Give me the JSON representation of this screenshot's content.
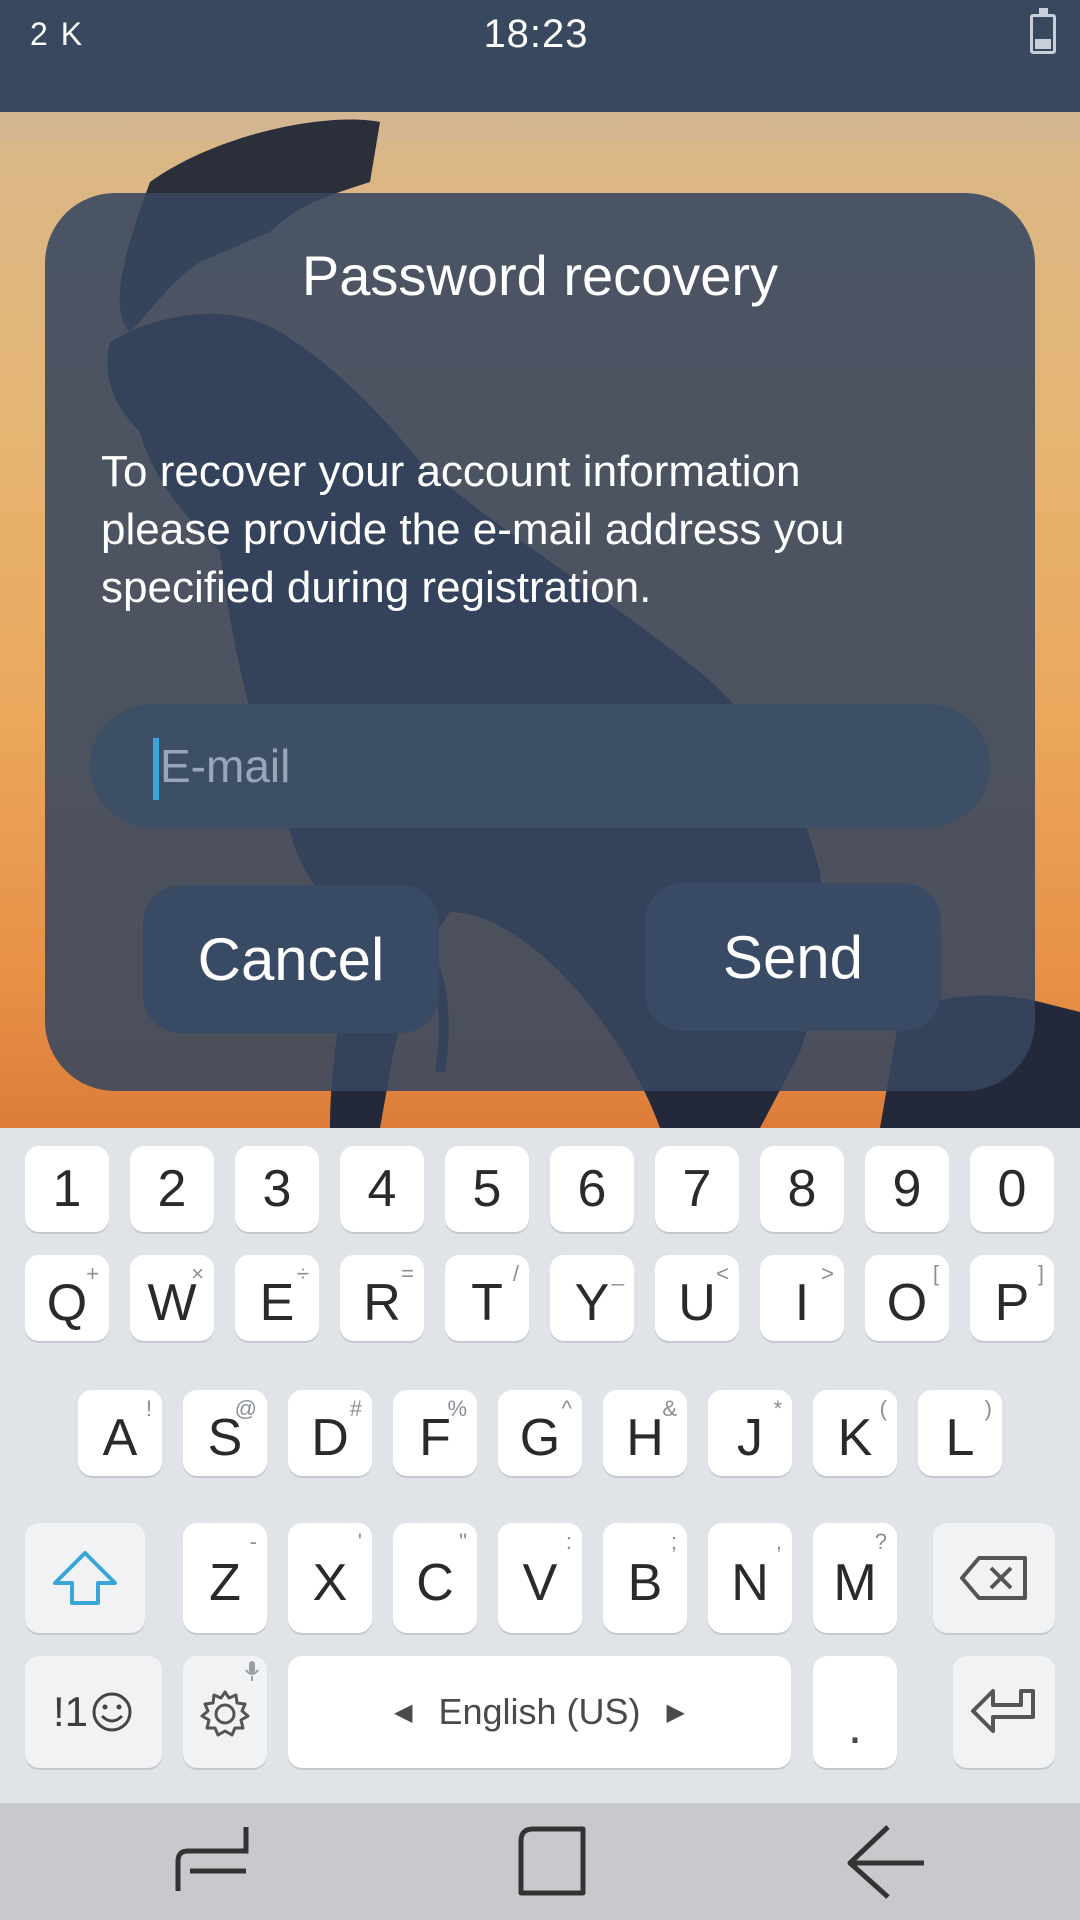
{
  "status_bar": {
    "left_text": "2 K",
    "time": "18:23"
  },
  "dialog": {
    "title": "Password recovery",
    "message": " To recover your account information\nplease provide the e-mail address you\nspecified during registration.",
    "email_placeholder": "E-mail",
    "email_value": "",
    "cancel_label": "Cancel",
    "send_label": "Send"
  },
  "keyboard": {
    "number_row": [
      "1",
      "2",
      "3",
      "4",
      "5",
      "6",
      "7",
      "8",
      "9",
      "0"
    ],
    "row1": [
      {
        "main": "Q",
        "sub": "+"
      },
      {
        "main": "W",
        "sub": "×"
      },
      {
        "main": "E",
        "sub": "÷"
      },
      {
        "main": "R",
        "sub": "="
      },
      {
        "main": "T",
        "sub": "/"
      },
      {
        "main": "Y",
        "sub": "_"
      },
      {
        "main": "U",
        "sub": "<"
      },
      {
        "main": "I",
        "sub": ">"
      },
      {
        "main": "O",
        "sub": "["
      },
      {
        "main": "P",
        "sub": "]"
      }
    ],
    "row2": [
      {
        "main": "A",
        "sub": "!"
      },
      {
        "main": "S",
        "sub": "@"
      },
      {
        "main": "D",
        "sub": "#"
      },
      {
        "main": "F",
        "sub": "%"
      },
      {
        "main": "G",
        "sub": "^"
      },
      {
        "main": "H",
        "sub": "&"
      },
      {
        "main": "J",
        "sub": "*"
      },
      {
        "main": "K",
        "sub": "("
      },
      {
        "main": "L",
        "sub": ")"
      }
    ],
    "row3": [
      {
        "main": "Z",
        "sub": "-"
      },
      {
        "main": "X",
        "sub": "'"
      },
      {
        "main": "C",
        "sub": "\""
      },
      {
        "main": "V",
        "sub": ":"
      },
      {
        "main": "B",
        "sub": ";"
      },
      {
        "main": "N",
        "sub": ","
      },
      {
        "main": "M",
        "sub": "?"
      }
    ],
    "symbols_label": "!1",
    "space_label": "English (US)",
    "period_label": ".",
    "icons": {
      "shift": "shift-arrow-icon",
      "backspace": "backspace-icon",
      "emoji": "emoji-icon",
      "settings": "gear-icon",
      "mic": "microphone-icon",
      "enter": "enter-icon"
    }
  },
  "nav_bar": {
    "icons": [
      "recent-apps-icon",
      "home-icon",
      "back-icon"
    ]
  },
  "colors": {
    "accent": "#3aa6d8",
    "dialog_bg": "#374760",
    "status_bar": "#37485f"
  }
}
